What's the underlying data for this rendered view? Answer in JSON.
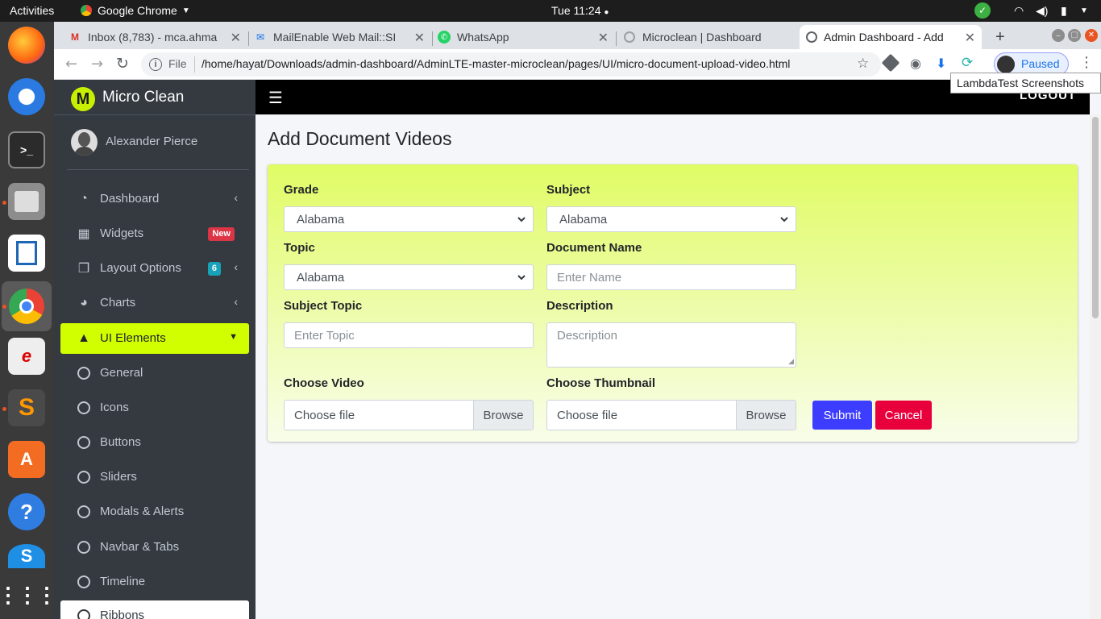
{
  "system": {
    "activities": "Activities",
    "app_name": "Google Chrome",
    "clock": "Tue 11:24"
  },
  "browser": {
    "tabs": [
      {
        "title": "Inbox (8,783) - mca.ahma",
        "icon": "gmail-icon"
      },
      {
        "title": "MailEnable Web Mail::SI",
        "icon": "mail-icon"
      },
      {
        "title": "WhatsApp",
        "icon": "whatsapp-icon"
      },
      {
        "title": "Microclean | Dashboard",
        "icon": "loading-icon"
      },
      {
        "title": "Admin Dashboard - Add",
        "icon": "globe-icon"
      }
    ],
    "url_scheme": "File",
    "url": "/home/hayat/Downloads/admin-dashboard/AdminLTE-master-microclean/pages/UI/micro-document-upload-video.html",
    "profile_status": "Paused",
    "tooltip": "LambdaTest Screenshots"
  },
  "sidebar": {
    "brand_letter": "M",
    "brand": "Micro Clean",
    "user": "Alexander Pierce",
    "items": [
      {
        "label": "Dashboard",
        "icon": "tachometer-icon",
        "chevron": true
      },
      {
        "label": "Widgets",
        "icon": "grid-icon",
        "badge": "New"
      },
      {
        "label": "Layout Options",
        "icon": "copy-icon",
        "badge": "6",
        "chevron": true
      },
      {
        "label": "Charts",
        "icon": "pie-chart-icon",
        "chevron": true
      },
      {
        "label": "UI Elements",
        "icon": "tree-icon",
        "expanded": true
      },
      {
        "label": "General",
        "icon": "circle-icon"
      },
      {
        "label": "Icons",
        "icon": "circle-icon"
      },
      {
        "label": "Buttons",
        "icon": "circle-icon"
      },
      {
        "label": "Sliders",
        "icon": "circle-icon"
      },
      {
        "label": "Modals & Alerts",
        "icon": "circle-icon"
      },
      {
        "label": "Navbar & Tabs",
        "icon": "circle-icon"
      },
      {
        "label": "Timeline",
        "icon": "circle-icon"
      },
      {
        "label": "Ribbons",
        "icon": "circle-icon"
      }
    ]
  },
  "navbar": {
    "logout": "LOGOUT"
  },
  "page": {
    "title": "Add Document Videos",
    "form": {
      "grade_label": "Grade",
      "grade_value": "Alabama",
      "subject_label": "Subject",
      "subject_value": "Alabama",
      "topic_label": "Topic",
      "topic_value": "Alabama",
      "document_name_label": "Document Name",
      "document_name_placeholder": "Enter Name",
      "subject_topic_label": "Subject Topic",
      "subject_topic_placeholder": "Enter Topic",
      "description_label": "Description",
      "description_placeholder": "Description",
      "choose_video_label": "Choose Video",
      "choose_thumbnail_label": "Choose Thumbnail",
      "file_placeholder": "Choose file",
      "browse": "Browse",
      "submit": "Submit",
      "cancel": "Cancel"
    }
  },
  "colors": {
    "accent": "#d1ff00",
    "submit": "#3d3dff",
    "cancel": "#e8003d",
    "sidebar": "#343a40",
    "badge_new": "#dc3545",
    "badge_count": "#17a2b8"
  }
}
